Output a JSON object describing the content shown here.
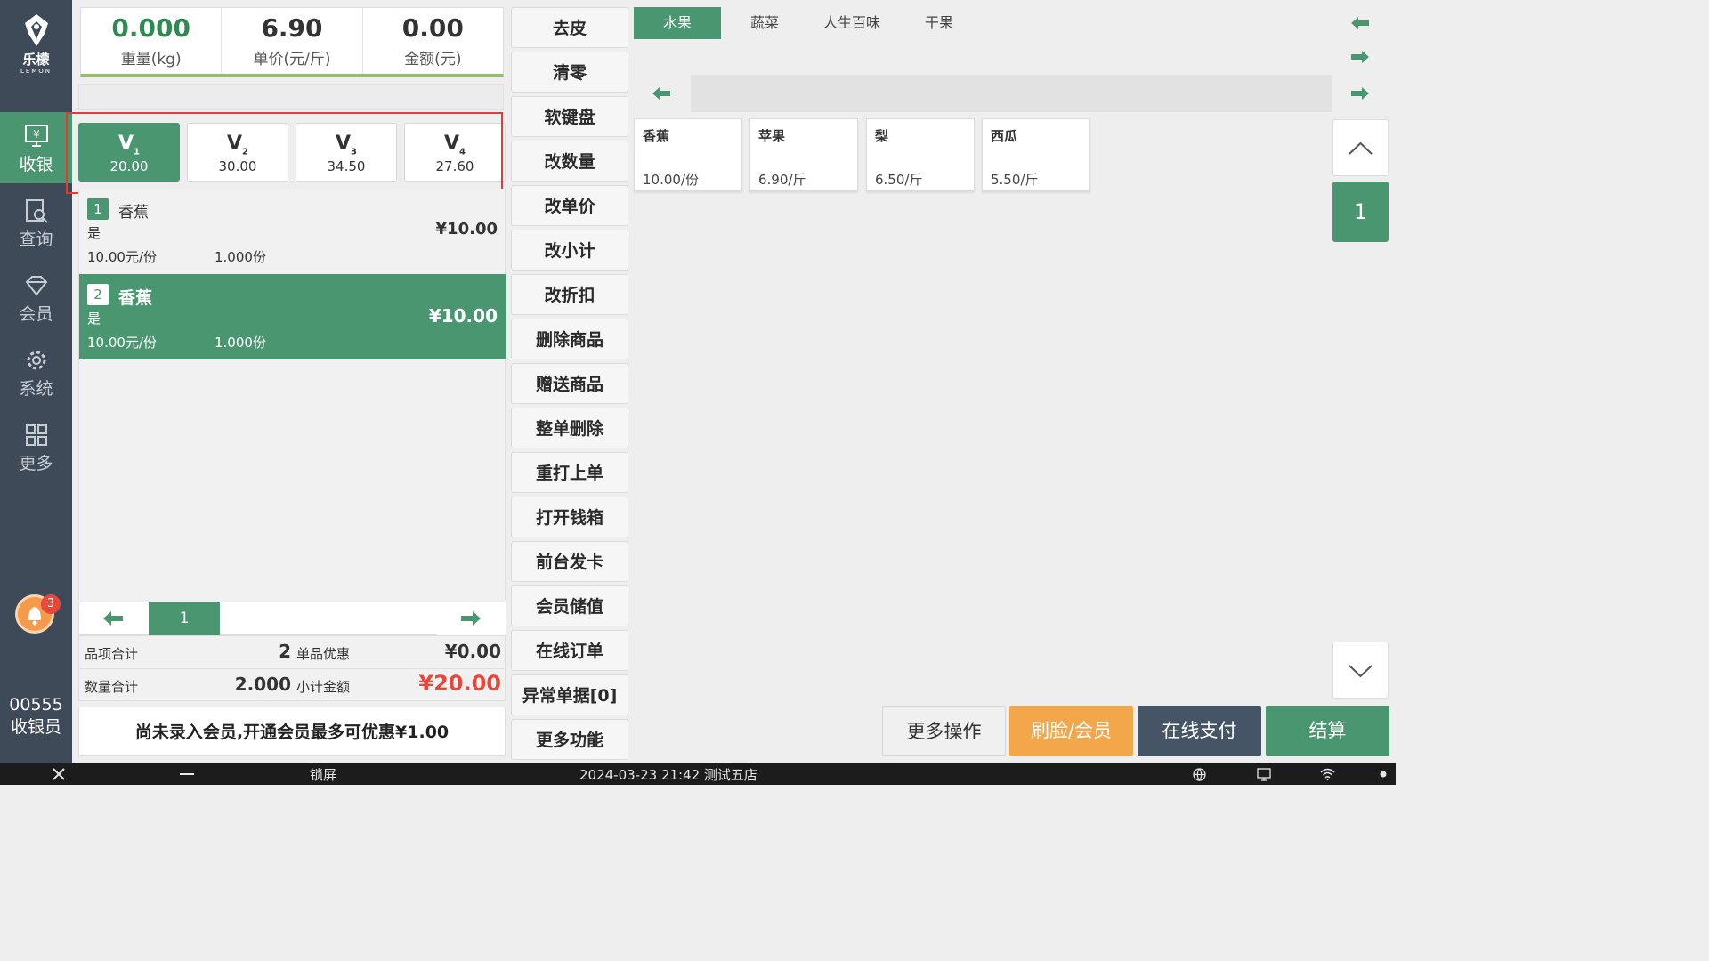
{
  "sidebar": {
    "logo_cn": "乐檬",
    "logo_en": "LEMON",
    "nav": [
      {
        "label": "收银",
        "icon": "cashier-icon"
      },
      {
        "label": "查询",
        "icon": "search-doc-icon"
      },
      {
        "label": "会员",
        "icon": "diamond-icon"
      },
      {
        "label": "系统",
        "icon": "gear-icon"
      },
      {
        "label": "更多",
        "icon": "grid-icon"
      }
    ],
    "notification_count": "3",
    "cashier_number": "00555",
    "cashier_role": "收银员"
  },
  "metrics": {
    "weight_value": "0.000",
    "weight_label": "重量(kg)",
    "price_value": "6.90",
    "price_label": "单价(元/斤)",
    "amount_value": "0.00",
    "amount_label": "金额(元)"
  },
  "levels": [
    {
      "name": "V",
      "sub": "1",
      "price": "20.00"
    },
    {
      "name": "V",
      "sub": "2",
      "price": "30.00"
    },
    {
      "name": "V",
      "sub": "3",
      "price": "34.50"
    },
    {
      "name": "V",
      "sub": "4",
      "price": "27.60"
    }
  ],
  "cart": [
    {
      "index": "1",
      "name": "香蕉",
      "flag": "是",
      "amount": "¥10.00",
      "unit_price": "10.00元/份",
      "qty": "1.000份"
    },
    {
      "index": "2",
      "name": "香蕉",
      "flag": "是",
      "amount": "¥10.00",
      "unit_price": "10.00元/份",
      "qty": "1.000份"
    }
  ],
  "pager": {
    "current": "1"
  },
  "totals": {
    "items_label": "品项合计",
    "items_value": "2",
    "item_discount_label": "单品优惠",
    "item_discount_value": "¥0.00",
    "qty_label": "数量合计",
    "qty_value": "2.000",
    "subtotal_label": "小计金额",
    "subtotal_value": "¥20.00"
  },
  "member_tip": "尚未录入会员,开通会员最多可优惠¥1.00",
  "functions": [
    "去皮",
    "清零",
    "软键盘",
    "改数量",
    "改单价",
    "改小计",
    "改折扣",
    "删除商品",
    "赠送商品",
    "整单删除",
    "重打上单",
    "打开钱箱",
    "前台发卡",
    "会员储值",
    "在线订单",
    "异常单据[0]",
    "更多功能"
  ],
  "categories": [
    "水果",
    "蔬菜",
    "人生百味",
    "干果"
  ],
  "products": [
    {
      "name": "香蕉",
      "price": "10.00/份"
    },
    {
      "name": "苹果",
      "price": "6.90/斤"
    },
    {
      "name": "梨",
      "price": "6.50/斤"
    },
    {
      "name": "西瓜",
      "price": "5.50/斤"
    }
  ],
  "product_page": "1",
  "actions": {
    "more_ops": "更多操作",
    "face_member": "刷脸/会员",
    "online_pay": "在线支付",
    "checkout": "结算"
  },
  "colors": {
    "accent": "#4a9670",
    "sidebar": "#3e4a58",
    "orange": "#f4a64a",
    "dark": "#455565",
    "red": "#e8473c"
  },
  "taskbar": {
    "lock": "锁屏",
    "datetime_store": "2024-03-23 21:42 测试五店"
  }
}
